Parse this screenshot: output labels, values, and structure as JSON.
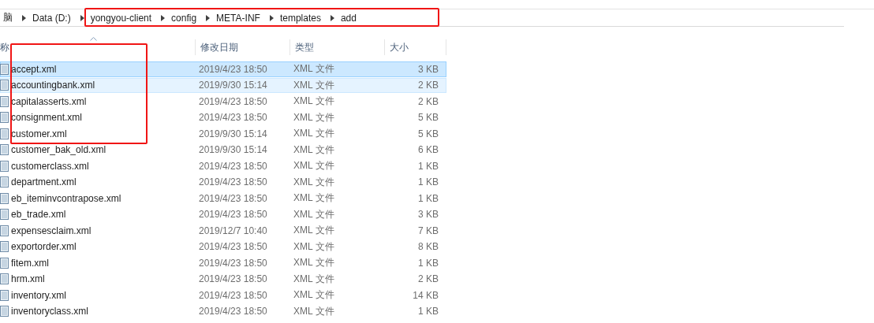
{
  "breadcrumb": [
    {
      "label": "脑"
    },
    {
      "label": "Data (D:)"
    },
    {
      "label": "yongyou-client"
    },
    {
      "label": "config"
    },
    {
      "label": "META-INF"
    },
    {
      "label": "templates"
    },
    {
      "label": "add"
    }
  ],
  "table": {
    "columns": [
      "称",
      "修改日期",
      "类型",
      "大小"
    ],
    "rows": [
      {
        "name": "accept.xml",
        "date": "2019/4/23 18:50",
        "type": "XML 文件",
        "size": "3 KB",
        "selected": true,
        "hovered": false
      },
      {
        "name": "accountingbank.xml",
        "date": "2019/9/30 15:14",
        "type": "XML 文件",
        "size": "2 KB",
        "selected": false,
        "hovered": true
      },
      {
        "name": "capitalasserts.xml",
        "date": "2019/4/23 18:50",
        "type": "XML 文件",
        "size": "2 KB",
        "selected": false,
        "hovered": false
      },
      {
        "name": "consignment.xml",
        "date": "2019/4/23 18:50",
        "type": "XML 文件",
        "size": "5 KB",
        "selected": false,
        "hovered": false
      },
      {
        "name": "customer.xml",
        "date": "2019/9/30 15:14",
        "type": "XML 文件",
        "size": "5 KB",
        "selected": false,
        "hovered": false
      },
      {
        "name": "customer_bak_old.xml",
        "date": "2019/9/30 15:14",
        "type": "XML 文件",
        "size": "6 KB",
        "selected": false,
        "hovered": false
      },
      {
        "name": "customerclass.xml",
        "date": "2019/4/23 18:50",
        "type": "XML 文件",
        "size": "1 KB",
        "selected": false,
        "hovered": false
      },
      {
        "name": "department.xml",
        "date": "2019/4/23 18:50",
        "type": "XML 文件",
        "size": "1 KB",
        "selected": false,
        "hovered": false
      },
      {
        "name": "eb_iteminvcontrapose.xml",
        "date": "2019/4/23 18:50",
        "type": "XML 文件",
        "size": "1 KB",
        "selected": false,
        "hovered": false
      },
      {
        "name": "eb_trade.xml",
        "date": "2019/4/23 18:50",
        "type": "XML 文件",
        "size": "3 KB",
        "selected": false,
        "hovered": false
      },
      {
        "name": "expensesclaim.xml",
        "date": "2019/12/7 10:40",
        "type": "XML 文件",
        "size": "7 KB",
        "selected": false,
        "hovered": false
      },
      {
        "name": "exportorder.xml",
        "date": "2019/4/23 18:50",
        "type": "XML 文件",
        "size": "8 KB",
        "selected": false,
        "hovered": false
      },
      {
        "name": "fitem.xml",
        "date": "2019/4/23 18:50",
        "type": "XML 文件",
        "size": "1 KB",
        "selected": false,
        "hovered": false
      },
      {
        "name": "hrm.xml",
        "date": "2019/4/23 18:50",
        "type": "XML 文件",
        "size": "2 KB",
        "selected": false,
        "hovered": false
      },
      {
        "name": "inventory.xml",
        "date": "2019/4/23 18:50",
        "type": "XML 文件",
        "size": "14 KB",
        "selected": false,
        "hovered": false
      },
      {
        "name": "inventoryclass.xml",
        "date": "2019/4/23 18:50",
        "type": "XML 文件",
        "size": "1 KB",
        "selected": false,
        "hovered": false
      }
    ]
  }
}
